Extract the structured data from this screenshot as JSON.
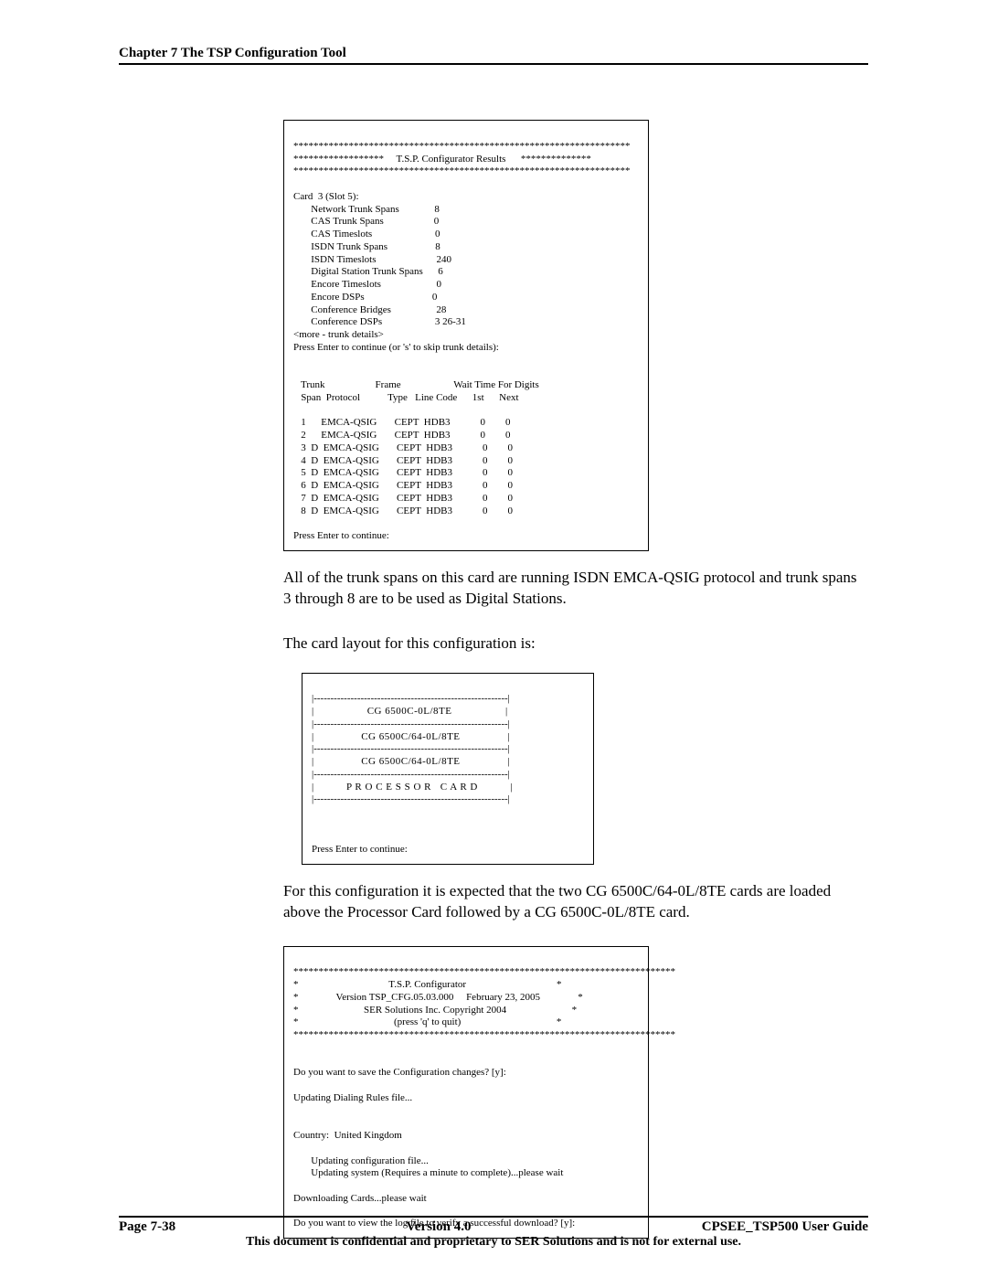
{
  "header": {
    "chapter": "Chapter 7 The TSP Configuration Tool"
  },
  "terminal1": {
    "star_top": "*******************************************************************",
    "title_line": "******************     T.S.P. Configurator Results      **************",
    "star_bot": "*******************************************************************",
    "card_line": "Card  3 (Slot 5):",
    "rows": [
      {
        "label": "Network Trunk Spans",
        "value": "8"
      },
      {
        "label": "CAS Trunk Spans",
        "value": "0"
      },
      {
        "label": "CAS Timeslots",
        "value": "0"
      },
      {
        "label": "ISDN Trunk Spans",
        "value": "8"
      },
      {
        "label": "ISDN Timeslots",
        "value": "240"
      },
      {
        "label": "Digital Station Trunk Spans",
        "value": "6"
      },
      {
        "label": "Encore Timeslots",
        "value": "0"
      },
      {
        "label": "Encore DSPs",
        "value": "0"
      },
      {
        "label": "Conference Bridges",
        "value": "28"
      },
      {
        "label": "Conference DSPs",
        "value": "3 26-31"
      }
    ],
    "more_line": "<more - trunk details>",
    "prompt1": "Press Enter to continue (or 's' to skip trunk details):",
    "tbl_hdr1": "   Trunk                    Frame                     Wait Time For Digits",
    "tbl_hdr2": "   Span  Protocol           Type   Line Code      1st      Next",
    "tbl_rows": [
      "   1      EMCA-QSIG       CEPT  HDB3            0        0",
      "   2      EMCA-QSIG       CEPT  HDB3            0        0",
      "   3  D  EMCA-QSIG       CEPT  HDB3            0        0",
      "   4  D  EMCA-QSIG       CEPT  HDB3            0        0",
      "   5  D  EMCA-QSIG       CEPT  HDB3            0        0",
      "   6  D  EMCA-QSIG       CEPT  HDB3            0        0",
      "   7  D  EMCA-QSIG       CEPT  HDB3            0        0",
      "   8  D  EMCA-QSIG       CEPT  HDB3            0        0"
    ],
    "prompt2": "Press Enter to continue:"
  },
  "para1": "All of the trunk spans on this card are running ISDN EMCA-QSIG protocol and trunk spans 3 through 8 are to be used as Digital Stations.",
  "para2": "The card layout for this configuration is:",
  "terminal2": {
    "dash": "|----------------------------------------------------------|",
    "slots": [
      "CG 6500C-0L/8TE",
      "CG 6500C/64-0L/8TE",
      "CG 6500C/64-0L/8TE",
      "P R O C E S S O R   C A R D"
    ],
    "prompt": "Press Enter to continue:"
  },
  "para3": "For this configuration it is expected that the two CG 6500C/64-0L/8TE cards are loaded above the Processor Card followed by a CG 6500C-0L/8TE card.",
  "terminal3": {
    "star": "****************************************************************************",
    "l1": "*                                    T.S.P. Configurator                                    *",
    "l2": "*               Version TSP_CFG.05.03.000     February 23, 2005               *",
    "l3": "*                          SER Solutions Inc. Copyright 2004                          *",
    "l4": "*                                      (press 'q' to quit)                                      *",
    "p1": "Do you want to save the Configuration changes? [y]:",
    "p2": "Updating Dialing Rules file...",
    "p3": "Country:  United Kingdom",
    "p4": "       Updating configuration file...",
    "p5": "       Updating system (Requires a minute to complete)...please wait",
    "p6": "Downloading Cards...please wait",
    "p7": "Do you want to view the log file to verify a successful download? [y]:"
  },
  "footer": {
    "page": "Page 7-38",
    "version": "Version 4.0",
    "guide": "CPSEE_TSP500 User Guide",
    "confidential": "This document is confidential and proprietary to SER Solutions and is not for external use."
  }
}
